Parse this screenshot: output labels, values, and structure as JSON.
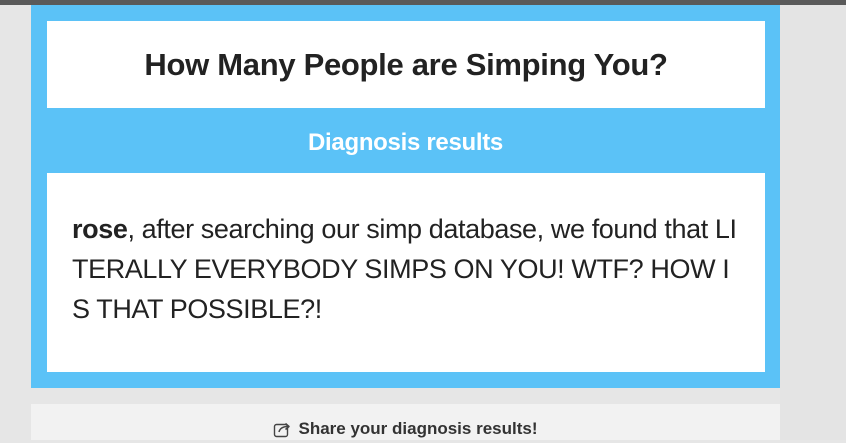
{
  "header": {
    "title": "How Many People are Simping You?"
  },
  "results": {
    "label": "Diagnosis results",
    "name": "rose",
    "text": ", after searching our simp database, we found that LITERALLY EVERYBODY SIMPS ON YOU! WTF? HOW IS THAT POSSIBLE?!"
  },
  "share": {
    "label": "Share your diagnosis results!",
    "icon": "share-icon"
  },
  "colors": {
    "accent": "#5bc2f7",
    "text": "#222222"
  }
}
